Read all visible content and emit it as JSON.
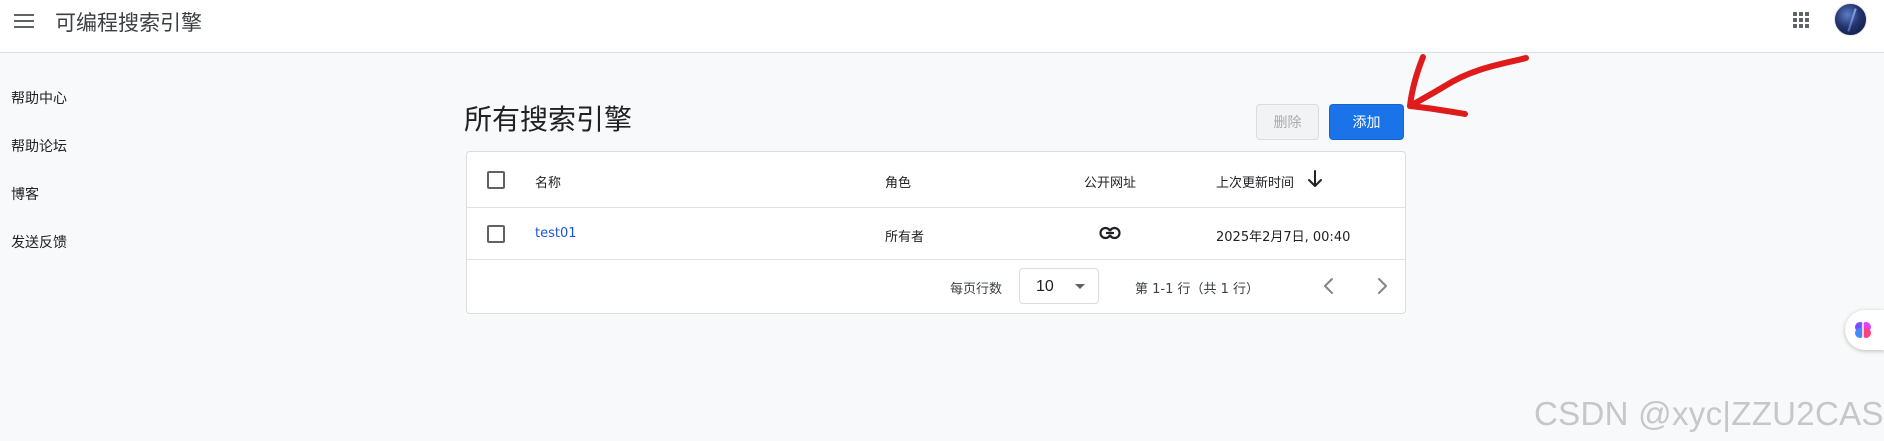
{
  "app": {
    "title": "可编程搜索引擎"
  },
  "sidebar": {
    "items": [
      {
        "label": "帮助中心"
      },
      {
        "label": "帮助论坛"
      },
      {
        "label": "博客"
      },
      {
        "label": "发送反馈"
      }
    ]
  },
  "main": {
    "title": "所有搜索引擎",
    "delete_label": "删除",
    "add_label": "添加"
  },
  "table": {
    "headers": {
      "name": "名称",
      "role": "角色",
      "public_url": "公开网址",
      "last_updated": "上次更新时间"
    },
    "sort": {
      "column": "last_updated",
      "direction": "descending"
    },
    "rows": [
      {
        "name": "test01",
        "role": "所有者",
        "public_url_icon": "link-icon",
        "last_updated": "2025年2月7日, 00:40"
      }
    ]
  },
  "pagination": {
    "rows_per_page_label": "每页行数",
    "rows_per_page": "10",
    "range": "第 1-1 行（共 1 行）"
  },
  "icons": {
    "menu": "hamburger-menu-icon",
    "apps": "apps-grid-icon",
    "sort": "arrow-down-icon",
    "prev": "chevron-left-icon",
    "next": "chevron-right-icon",
    "float": "brain-icon"
  },
  "colors": {
    "accent": "#1a73e8",
    "link": "#1a57d6",
    "annotation": "#e01b1b",
    "background": "#f8f9fa"
  },
  "watermark": "CSDN @xyc|ZZU2CAS"
}
